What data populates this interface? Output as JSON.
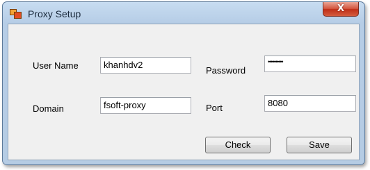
{
  "window": {
    "title": "Proxy Setup",
    "close_label": "X",
    "icon": "app-window-icon"
  },
  "form": {
    "username": {
      "label": "User Name",
      "value": "khanhdv2"
    },
    "password": {
      "label": "Password",
      "value": "••••••••••"
    },
    "domain": {
      "label": "Domain",
      "value": "fsoft-proxy"
    },
    "port": {
      "label": "Port",
      "value": "8080"
    }
  },
  "buttons": {
    "check_label": "Check",
    "save_label": "Save"
  }
}
